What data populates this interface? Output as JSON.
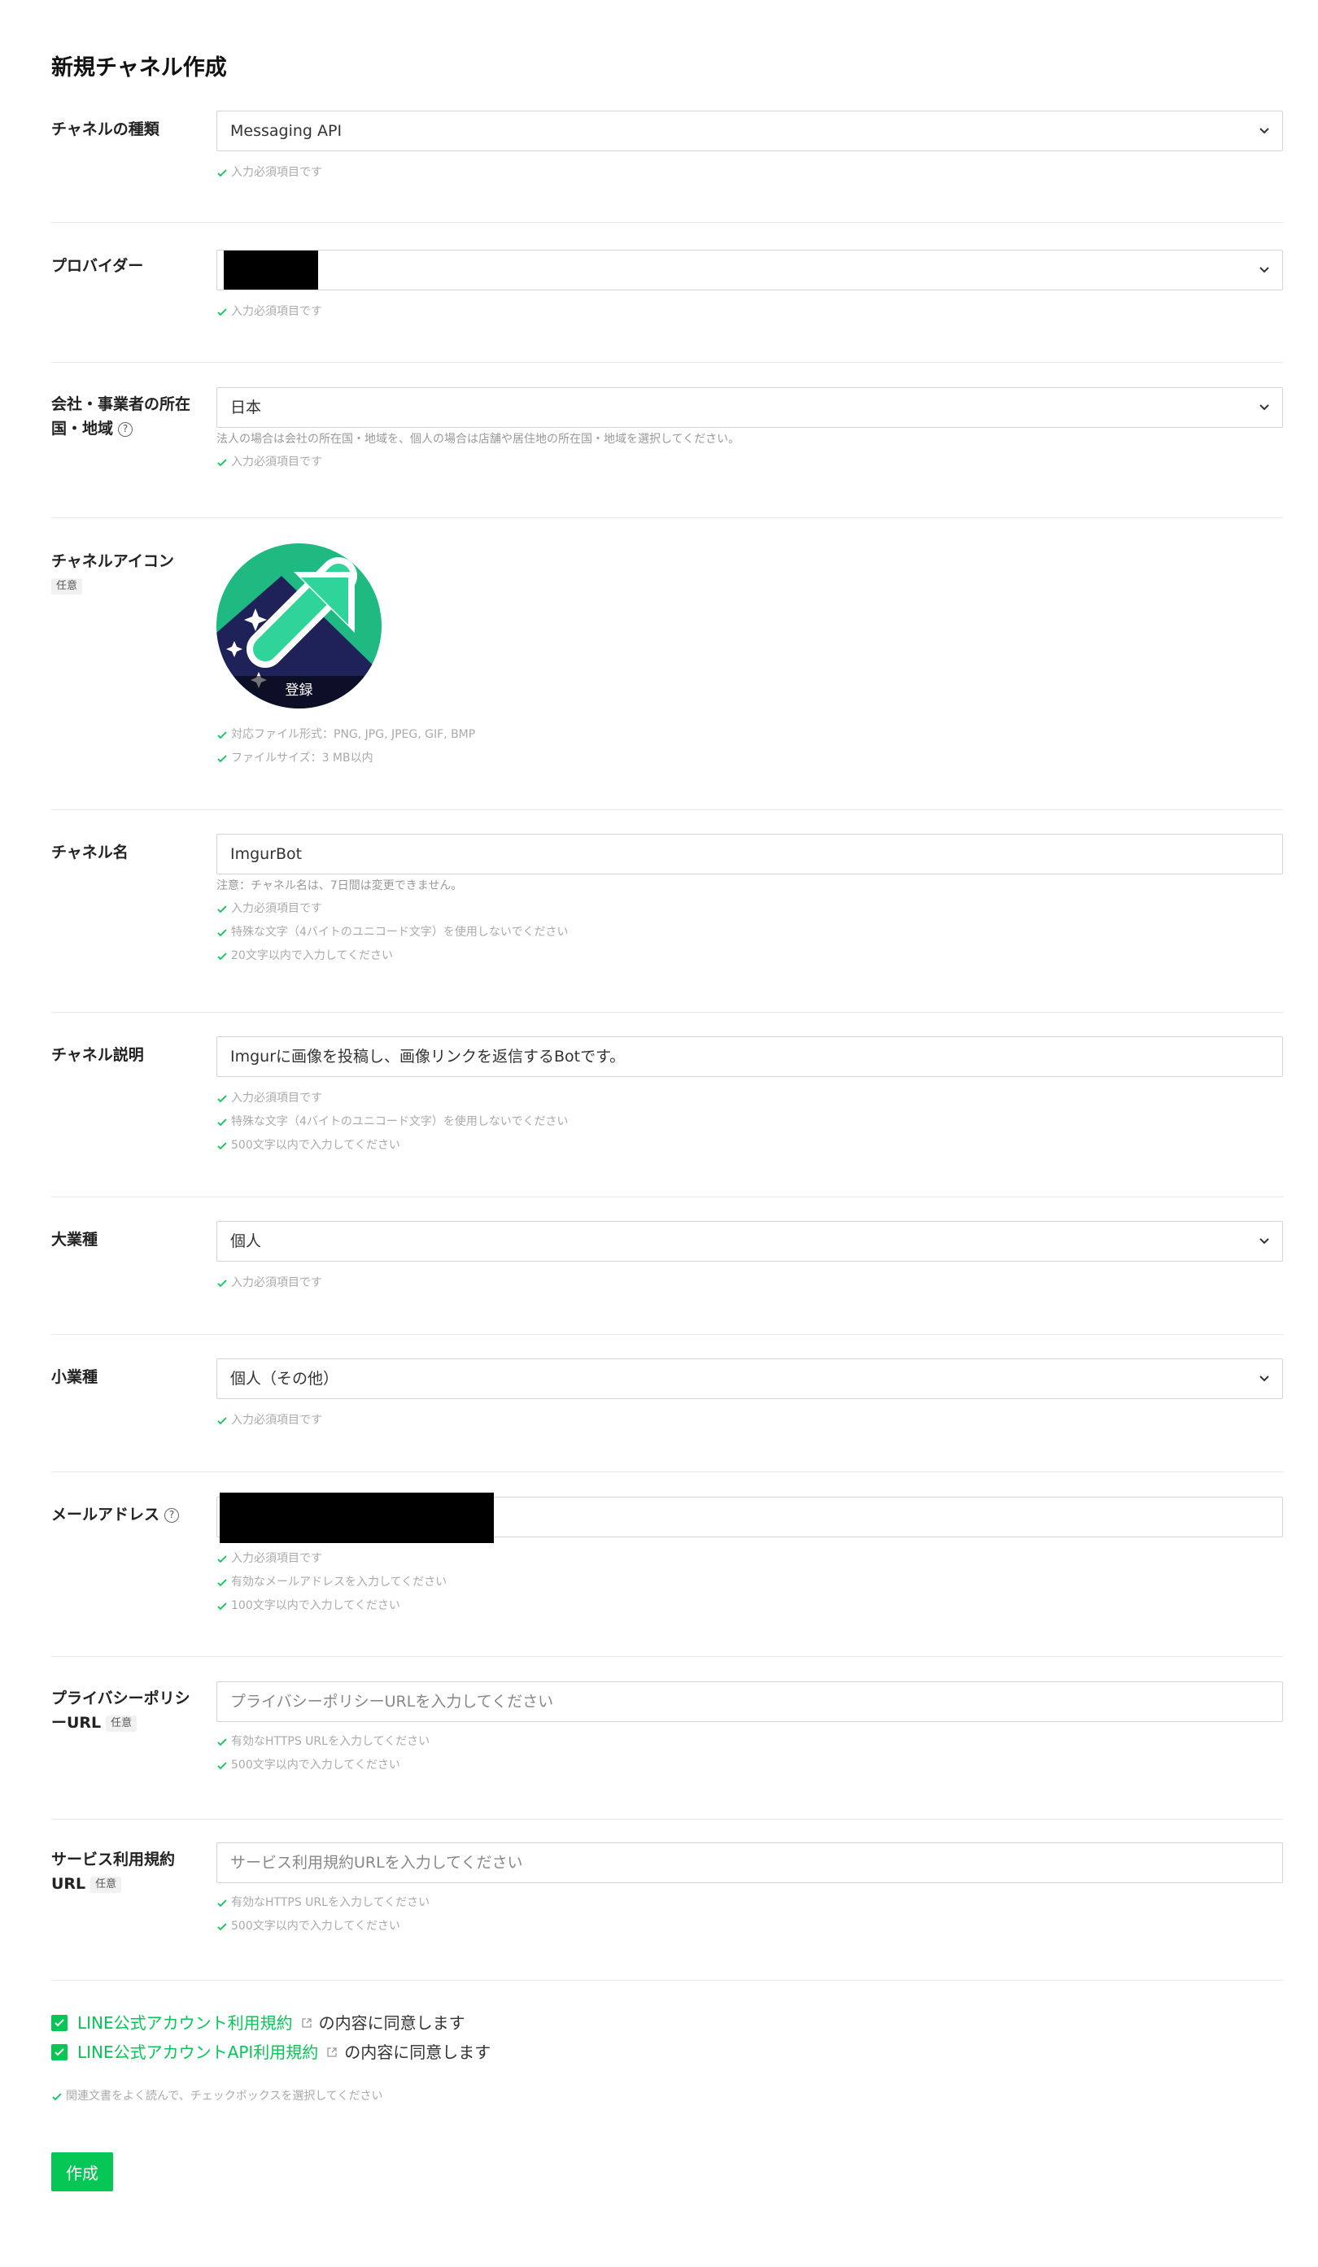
{
  "page": {
    "title": "新規チャネル作成"
  },
  "colors": {
    "accent": "#06c755",
    "hint": "#aaaaaa",
    "border": "#d4d4d4"
  },
  "fields": {
    "channel_type": {
      "label": "チャネルの種類",
      "value": "Messaging API",
      "validations": [
        "入力必須項目です"
      ]
    },
    "provider": {
      "label": "プロバイダー",
      "value": "",
      "validations": [
        "入力必須項目です"
      ]
    },
    "country": {
      "label": "会社・事業者の所在国・地域",
      "value": "日本",
      "note": "法人の場合は会社の所在国・地域を、個人の場合は店舗や居住地の所在国・地域を選択してください。",
      "validations": [
        "入力必須項目です"
      ]
    },
    "icon": {
      "label": "チャネルアイコン",
      "optional": "任意",
      "caption": "登録",
      "validations": [
        "対応ファイル形式：PNG, JPG, JPEG, GIF, BMP",
        "ファイルサイズ：3 MB以内"
      ]
    },
    "channel_name": {
      "label": "チャネル名",
      "value": "ImgurBot",
      "note": "注意：チャネル名は、7日間は変更できません。",
      "validations": [
        "入力必須項目です",
        "特殊な文字（4バイトのユニコード文字）を使用しないでください",
        "20文字以内で入力してください"
      ]
    },
    "description": {
      "label": "チャネル説明",
      "value": "Imgurに画像を投稿し、画像リンクを返信するBotです。",
      "validations": [
        "入力必須項目です",
        "特殊な文字（4バイトのユニコード文字）を使用しないでください",
        "500文字以内で入力してください"
      ]
    },
    "industry_major": {
      "label": "大業種",
      "value": "個人",
      "validations": [
        "入力必須項目です"
      ]
    },
    "industry_minor": {
      "label": "小業種",
      "value": "個人（その他）",
      "validations": [
        "入力必須項目です"
      ]
    },
    "email": {
      "label": "メールアドレス",
      "value": "",
      "validations": [
        "入力必須項目です",
        "有効なメールアドレスを入力してください",
        "100文字以内で入力してください"
      ]
    },
    "privacy_url": {
      "label_line1": "プライバシーポリシ",
      "label_line2": "ーURL",
      "optional": "任意",
      "placeholder": "プライバシーポリシーURLを入力してください",
      "validations": [
        "有効なHTTPS URLを入力してください",
        "500文字以内で入力してください"
      ]
    },
    "terms_url": {
      "label_line1": "サービス利用規約",
      "label_line2": "URL",
      "optional": "任意",
      "placeholder": "サービス利用規約URLを入力してください",
      "validations": [
        "有効なHTTPS URLを入力してください",
        "500文字以内で入力してください"
      ]
    }
  },
  "agreements": [
    {
      "link": "LINE公式アカウント利用規約",
      "suffix": "の内容に同意します",
      "checked": true
    },
    {
      "link": "LINE公式アカウントAPI利用規約",
      "suffix": "の内容に同意します",
      "checked": true
    }
  ],
  "agreement_hint": "関連文書をよく読んで、チェックボックスを選択してください",
  "submit_label": "作成"
}
